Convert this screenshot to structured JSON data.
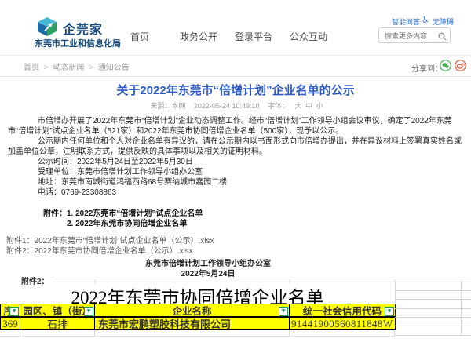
{
  "colors": {
    "accent_blue": "#2f5bc4",
    "link_blue": "#2a6fd0",
    "brand_navy": "#15497c",
    "highlight_yellow": "#ffff00",
    "filter_green": "#18a05c",
    "share_green": "#4caf50",
    "share_red": "#e4573d"
  },
  "header": {
    "brand": "企莞家",
    "org": "东莞市工业和信息化局",
    "top_links": [
      {
        "label": "智能问答"
      },
      {
        "label": "无障碍",
        "icon": "♿"
      }
    ],
    "nav": [
      "首页",
      "政务公开",
      "登录平台",
      "公众互动"
    ],
    "search": {
      "placeholder": "搜索更多内容"
    }
  },
  "breadcrumb": {
    "items": [
      "首页",
      "动态新闻",
      "通知公告"
    ],
    "separator": ">"
  },
  "share": {
    "label": "分享到："
  },
  "article": {
    "title": "关于2022年东莞市“倍增计划”企业名单的公示",
    "meta": {
      "source": "来源：本网",
      "datetime": "2022-05-24 10:49:10",
      "font_label": "字体：",
      "font_sizes": [
        "大",
        "中",
        "小"
      ]
    },
    "paragraphs": [
      "市倍增办开展了2022年东莞市“倍增计划”企业动态调整工作。经市“倍增计划”工作领导小组会议审议，确定了2022年东莞市“倍增计划”试点企业名单（521家）和2022年东莞市协同倍增企业名单（500家），现予以公示。",
      "公示期内任何单位和个人对企业名单有异议的，请在公示期内以书面形式向市倍增办提出，并在异议材料上签署真实姓名或加盖单位公章，注明联系方式，提供反映的具体事项以及相关的证明材料。",
      "公示时间：2022年5月24日至2022年5月30日",
      "受理单位：东莞市倍增计划工作领导小组办公室",
      "地址：东莞市南城街道鸿福西路68号赛纳城市嘉园二楼",
      "电话：0769-23308863"
    ],
    "attachments_heading": "附件：1. 2022东莞市“倍增计划”试点企业名单",
    "attachments_line2": "2. 2022年东莞市协同倍增企业名单",
    "attachment_links": [
      "附件1：2022年东莞市“倍增计划”试点企业名单（公示）.xlsx",
      "附件2：2022年东莞市协同倍增企业名单（公示）.xlsx"
    ],
    "signature": {
      "office": "东莞市倍增计划工作领导小组办公室",
      "date": "2022年5月24日"
    },
    "partial_attachment": "附件2："
  },
  "sheet": {
    "title": "2022年东莞市协同倍增企业名单",
    "columns": [
      "序·",
      "园区、镇（街）",
      "企业名称",
      "统一社会信用代码"
    ],
    "rows": [
      [
        "369",
        "石排",
        "东莞市宏鹏塑胶科技有限公司",
        "91441900560811848W"
      ]
    ],
    "filter_glyph": "▼"
  }
}
